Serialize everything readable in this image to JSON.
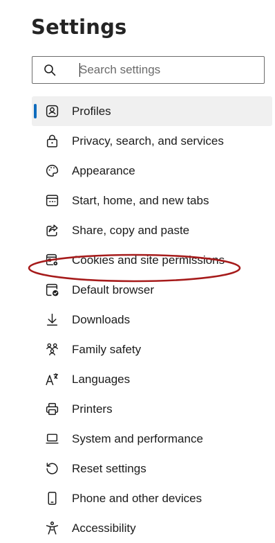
{
  "header": {
    "title": "Settings"
  },
  "search": {
    "placeholder": "Search settings",
    "value": "",
    "icon": "search-icon"
  },
  "nav": {
    "selected_index": 0,
    "accent_color": "#0f6cbd",
    "items": [
      {
        "label": "Profiles",
        "icon": "profile-icon"
      },
      {
        "label": "Privacy, search, and services",
        "icon": "lock-icon"
      },
      {
        "label": "Appearance",
        "icon": "palette-icon"
      },
      {
        "label": "Start, home, and new tabs",
        "icon": "start-page-icon"
      },
      {
        "label": "Share, copy and paste",
        "icon": "share-icon"
      },
      {
        "label": "Cookies and site permissions",
        "icon": "cookies-site-permissions-icon"
      },
      {
        "label": "Default browser",
        "icon": "default-browser-icon"
      },
      {
        "label": "Downloads",
        "icon": "download-icon"
      },
      {
        "label": "Family safety",
        "icon": "family-icon"
      },
      {
        "label": "Languages",
        "icon": "language-icon"
      },
      {
        "label": "Printers",
        "icon": "printer-icon"
      },
      {
        "label": "System and performance",
        "icon": "laptop-icon"
      },
      {
        "label": "Reset settings",
        "icon": "reset-icon"
      },
      {
        "label": "Phone and other devices",
        "icon": "phone-icon"
      },
      {
        "label": "Accessibility",
        "icon": "accessibility-icon"
      }
    ]
  },
  "annotation": {
    "highlighted_item": "Cookies and site permissions",
    "color": "#a61b1b"
  }
}
